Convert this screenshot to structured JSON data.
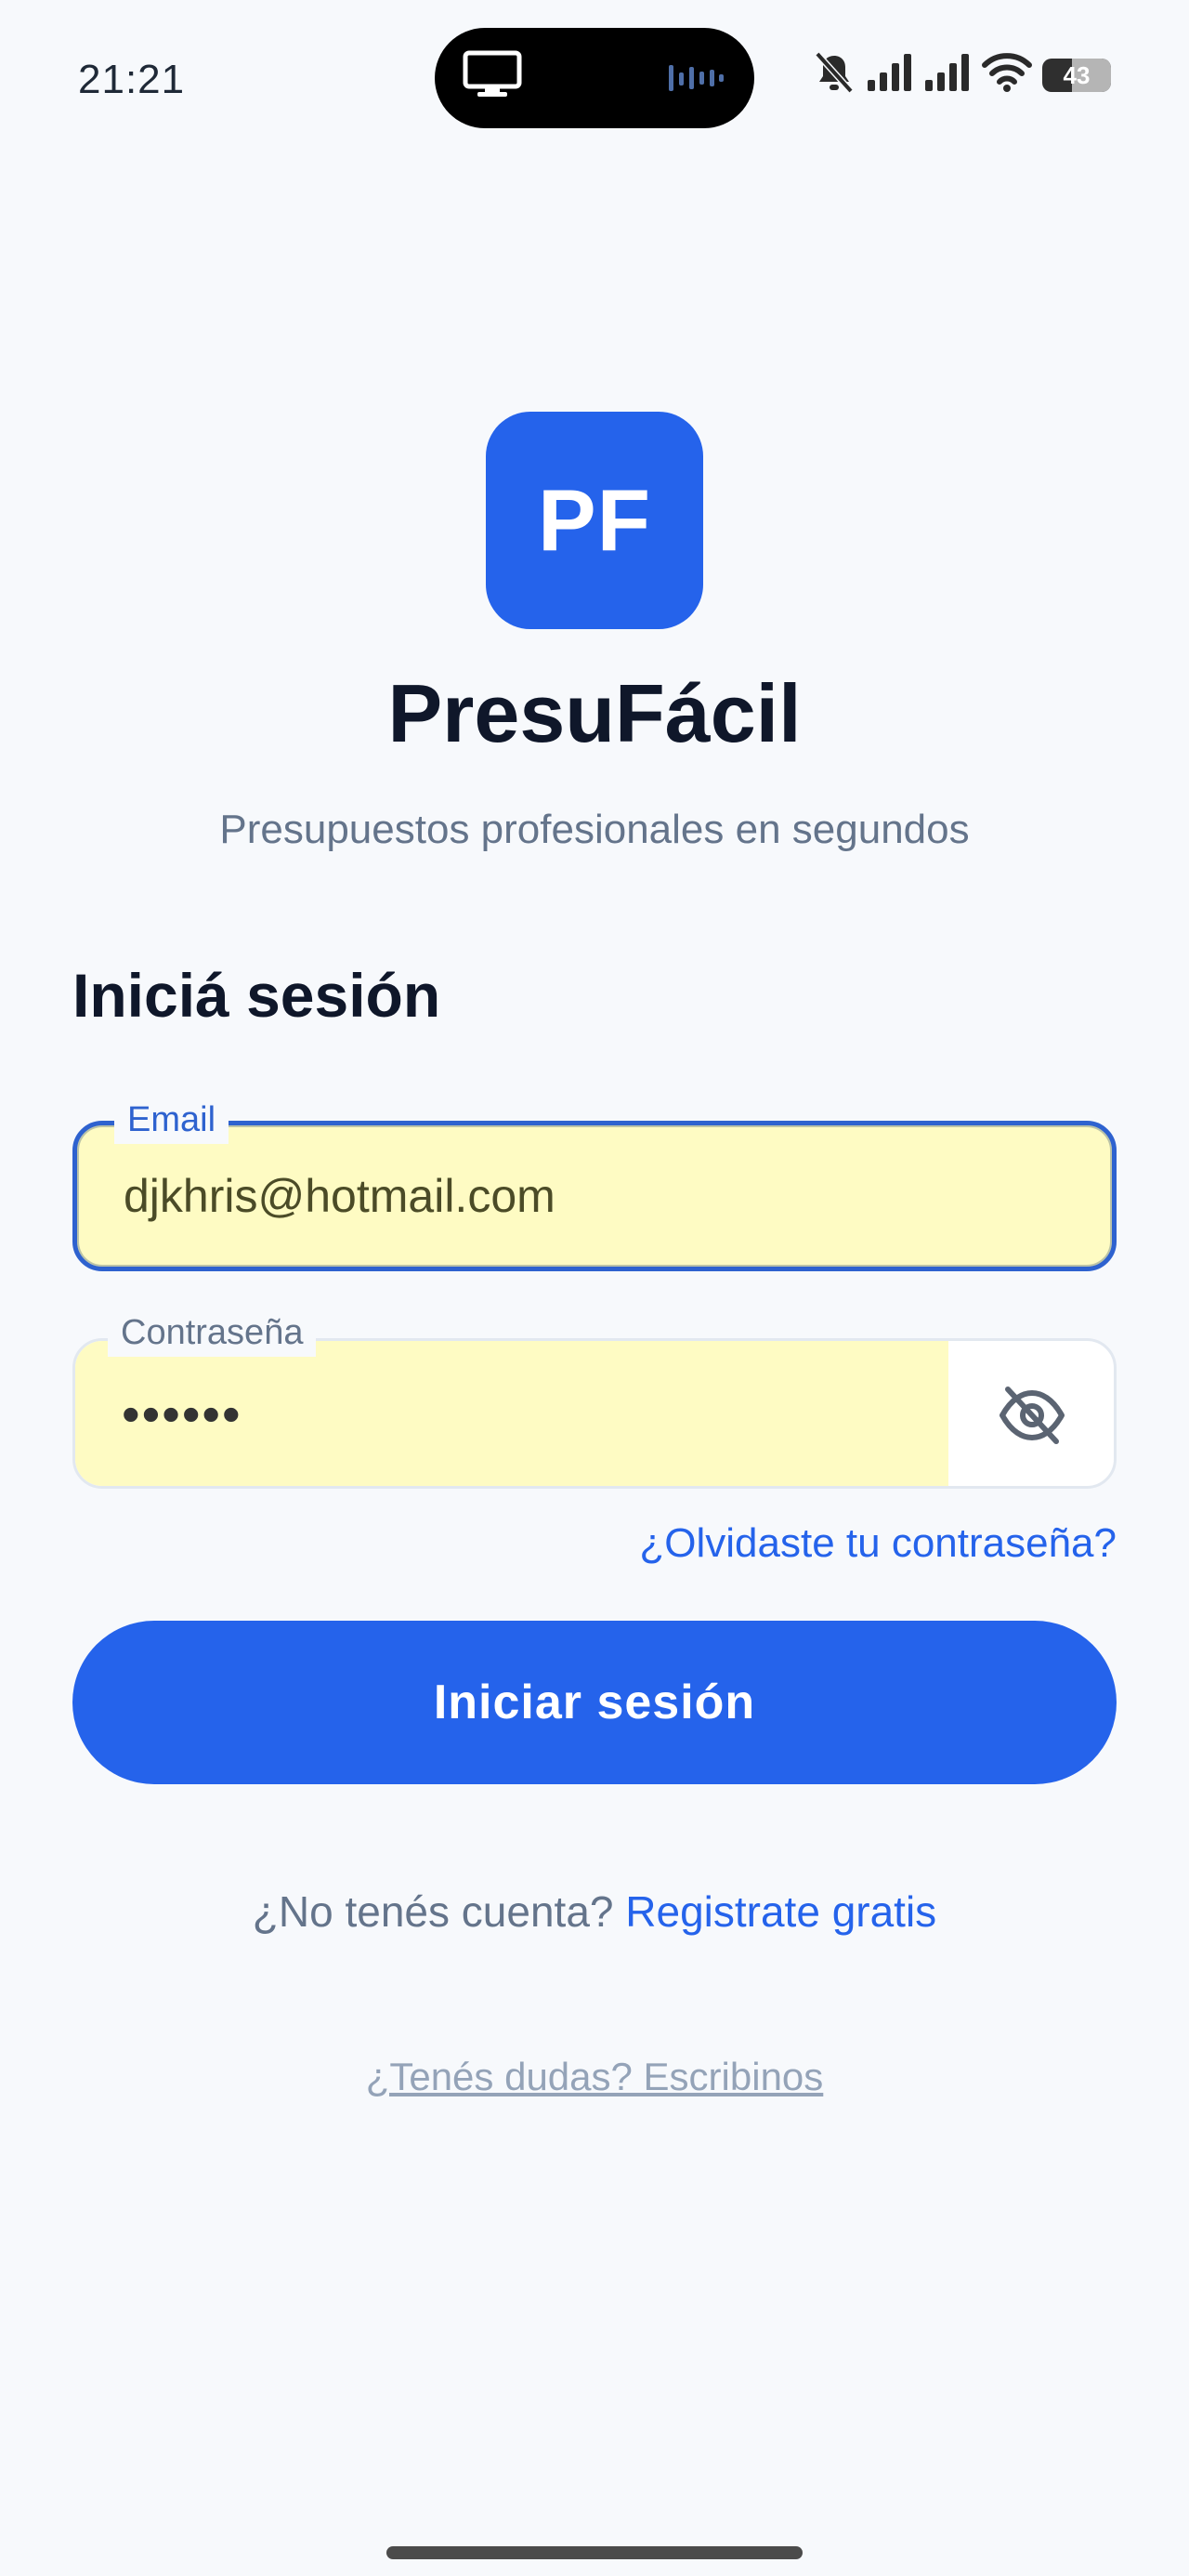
{
  "status_bar": {
    "time": "21:21",
    "battery_level": "43",
    "icons": [
      "screen-cast-icon",
      "audio-wave-icon",
      "bell-off-icon",
      "signal-icon",
      "signal-icon",
      "wifi-icon",
      "battery-icon"
    ]
  },
  "app": {
    "logo_text": "PF",
    "name": "PresuFácil",
    "tagline": "Presupuestos profesionales en segundos"
  },
  "login": {
    "title": "Iniciá sesión",
    "email_label": "Email",
    "email_value": "djkhris@hotmail.com",
    "password_label": "Contraseña",
    "password_value": "••••••",
    "password_toggle_icon": "eye-off-icon",
    "forgot_password": "¿Olvidaste tu contraseña?",
    "submit_label": "Iniciar sesión",
    "no_account_text": "¿No tenés cuenta?",
    "register_link": "Registrate gratis",
    "help_link": "¿Tenés dudas? Escribinos"
  },
  "colors": {
    "primary": "#2563eb",
    "background": "#f7f9fc",
    "autofill": "#fefbc3",
    "text_dark": "#0f172a",
    "text_muted": "#64748b"
  }
}
